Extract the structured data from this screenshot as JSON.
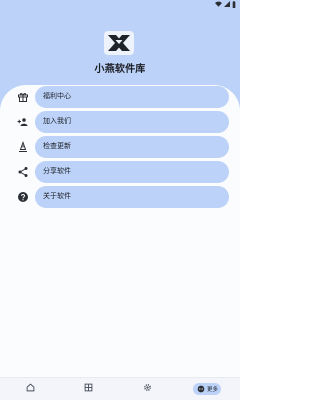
{
  "app": {
    "title": "小燕软件库"
  },
  "menu": {
    "items": [
      {
        "label": "福利中心",
        "icon": "gift-icon"
      },
      {
        "label": "加入我们",
        "icon": "group-add-icon"
      },
      {
        "label": "检查更新",
        "icon": "update-icon"
      },
      {
        "label": "分享软件",
        "icon": "share-icon"
      },
      {
        "label": "关于软件",
        "icon": "help-icon"
      }
    ]
  },
  "bottom_nav": {
    "items": [
      {
        "icon": "home-icon"
      },
      {
        "icon": "grid-icon"
      },
      {
        "icon": "gear-icon"
      }
    ],
    "active": {
      "label": "更多",
      "icon": "more-icon"
    }
  },
  "colors": {
    "accent": "#bcd2f8",
    "background": "#fbfcfe",
    "text": "#1a1d24"
  }
}
